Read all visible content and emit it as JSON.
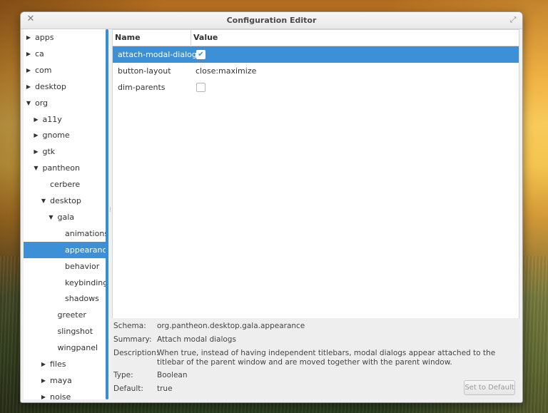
{
  "window": {
    "title": "Configuration Editor"
  },
  "sidebar": {
    "items": [
      {
        "label": "apps",
        "expander": "collapsed"
      },
      {
        "label": "ca",
        "expander": "collapsed"
      },
      {
        "label": "com",
        "expander": "collapsed"
      },
      {
        "label": "desktop",
        "expander": "collapsed"
      },
      {
        "label": "org",
        "expander": "expanded"
      },
      {
        "label": "a11y",
        "expander": "collapsed"
      },
      {
        "label": "gnome",
        "expander": "collapsed"
      },
      {
        "label": "gtk",
        "expander": "collapsed"
      },
      {
        "label": "pantheon",
        "expander": "expanded"
      },
      {
        "label": "cerbere",
        "expander": "none"
      },
      {
        "label": "desktop",
        "expander": "expanded"
      },
      {
        "label": "gala",
        "expander": "expanded"
      },
      {
        "label": "animations",
        "expander": "none"
      },
      {
        "label": "appearance",
        "expander": "none",
        "selected": true
      },
      {
        "label": "behavior",
        "expander": "none"
      },
      {
        "label": "keybindings",
        "expander": "none"
      },
      {
        "label": "shadows",
        "expander": "none"
      },
      {
        "label": "greeter",
        "expander": "none"
      },
      {
        "label": "slingshot",
        "expander": "none"
      },
      {
        "label": "wingpanel",
        "expander": "none"
      },
      {
        "label": "files",
        "expander": "collapsed"
      },
      {
        "label": "maya",
        "expander": "collapsed"
      },
      {
        "label": "noise",
        "expander": "collapsed"
      }
    ]
  },
  "table": {
    "headers": {
      "name": "Name",
      "value": "Value"
    },
    "rows": [
      {
        "name": "attach-modal-dialogs",
        "type": "checkbox",
        "checked": true,
        "selected": true
      },
      {
        "name": "button-layout",
        "type": "text",
        "value": "close:maximize"
      },
      {
        "name": "dim-parents",
        "type": "checkbox",
        "checked": false
      }
    ]
  },
  "details": {
    "schema_label": "Schema:",
    "schema_value": "org.pantheon.desktop.gala.appearance",
    "summary_label": "Summary:",
    "summary_value": "Attach modal dialogs",
    "description_label": "Description:",
    "description_value": "When true, instead of having independent titlebars, modal dialogs appear attached to the titlebar of the parent window and are moved together with the parent window.",
    "type_label": "Type:",
    "type_value": "Boolean",
    "default_label": "Default:",
    "default_value": "true",
    "set_default_label": "Set to Default"
  },
  "colors": {
    "selection": "#3d8fd6"
  },
  "icons": {
    "close": "close-icon",
    "maximize": "maximize-icon",
    "expanded": "triangle-down-icon",
    "collapsed": "triangle-right-icon",
    "check": "checkmark-icon"
  }
}
